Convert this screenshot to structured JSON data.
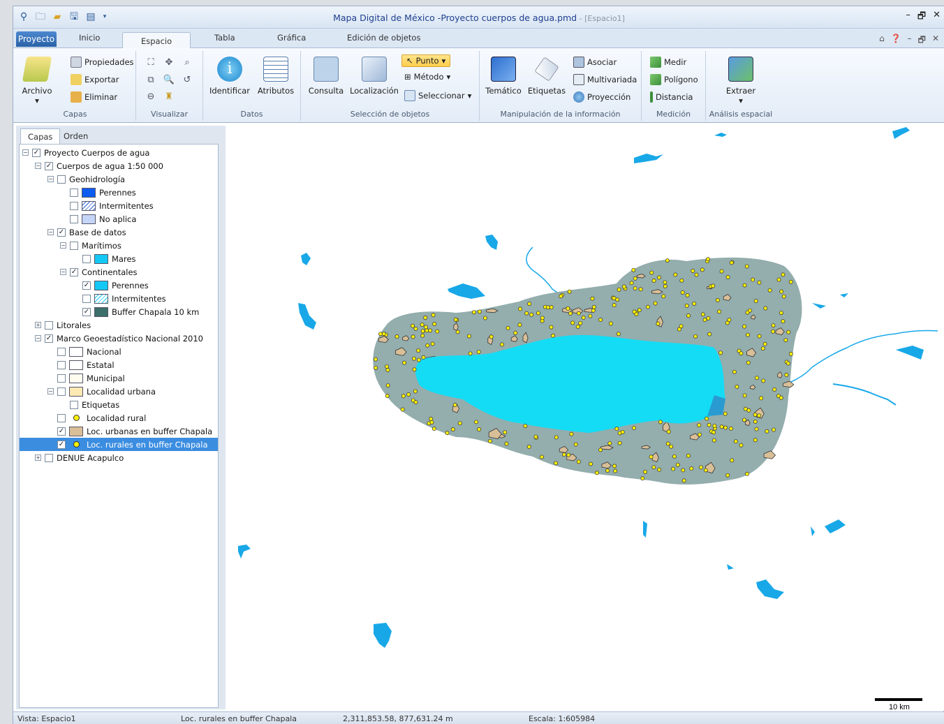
{
  "window": {
    "title": "Mapa Digital de México -Proyecto cuerpos de agua.pmd",
    "space": " - [Espacio1]",
    "controls": [
      "–",
      "🗗",
      "✕"
    ]
  },
  "quick_access": [
    "location-pin-icon",
    "open-folder-icon",
    "folder-icon",
    "save-icon",
    "table-icon"
  ],
  "ribbon_tabs": {
    "file": "Proyecto",
    "tabs": [
      "Inicio",
      "Espacio",
      "Tabla",
      "Gráfica",
      "Edición de objetos"
    ],
    "active": "Espacio"
  },
  "ribbon": {
    "capas": {
      "label": "Capas",
      "archivo": "Archivo",
      "propiedades": "Propiedades",
      "exportar": "Exportar",
      "eliminar": "Eliminar"
    },
    "visualizar": {
      "label": "Visualizar"
    },
    "datos": {
      "label": "Datos",
      "identificar": "Identificar",
      "atributos": "Atributos"
    },
    "seleccion": {
      "label": "Selección de objetos",
      "consulta": "Consulta",
      "localizacion": "Localización",
      "punto": "Punto",
      "metodo": "Método",
      "seleccionar": "Seleccionar"
    },
    "manipulacion": {
      "label": "Manipulación de la información",
      "tematico": "Temático",
      "etiquetas": "Etiquetas",
      "asociar": "Asociar",
      "multivariada": "Multivariada",
      "proyeccion": "Proyección"
    },
    "medicion": {
      "label": "Medición",
      "medir": "Medir",
      "poligono": "Polígono",
      "distancia": "Distancia"
    },
    "analisis": {
      "label": "Análisis espacial",
      "extraer": "Extraer"
    }
  },
  "panel_tabs": [
    "Capas",
    "Orden"
  ],
  "tree": [
    {
      "label": "Proyecto Cuerpos de agua",
      "exp": "⊟",
      "checked": true
    },
    {
      "label": "Cuerpos de agua 1:50 000",
      "exp": "⊟",
      "checked": true
    },
    {
      "label": "Geohidrología",
      "exp": "⊟",
      "checked": false
    },
    {
      "label": "Perennes",
      "checked": false,
      "swatch": "#0d5cf0"
    },
    {
      "label": "Intermitentes",
      "checked": false,
      "swatch": "hatch"
    },
    {
      "label": "No aplica",
      "checked": false,
      "swatch": "#c4d5f7"
    },
    {
      "label": "Base de datos",
      "exp": "⊟",
      "checked": true
    },
    {
      "label": "Marítimos",
      "exp": "⊟",
      "checked": false
    },
    {
      "label": "Mares",
      "checked": false,
      "swatch": "#14c8f5"
    },
    {
      "label": "Continentales",
      "exp": "⊟",
      "checked": true
    },
    {
      "label": "Perennes",
      "checked": true,
      "swatch": "#14c8f5"
    },
    {
      "label": "Intermitentes",
      "checked": false,
      "swatch": "hatch2"
    },
    {
      "label": "Buffer Chapala 10 km",
      "checked": true,
      "swatch": "#3c6e6a"
    },
    {
      "label": "Litorales",
      "exp": "⊞",
      "checked": false
    },
    {
      "label": "Marco Geoestadístico Nacional 2010",
      "exp": "⊟",
      "checked": true
    },
    {
      "label": "Nacional",
      "checked": false,
      "swatch": "#ffffff"
    },
    {
      "label": "Estatal",
      "checked": false,
      "swatch": "#ffffff"
    },
    {
      "label": "Municipal",
      "checked": false,
      "swatch": "#fffdf0"
    },
    {
      "label": "Localidad urbana",
      "exp": "⊟",
      "checked": false,
      "swatch": "#fde9b4"
    },
    {
      "label": "Etiquetas",
      "checked": false
    },
    {
      "label": "Localidad rural",
      "checked": false,
      "swatch": "dot"
    },
    {
      "label": "Loc. urbanas en buffer Chapala",
      "checked": true,
      "swatch": "#d9bf98"
    },
    {
      "label": "Loc. rurales en buffer Chapala",
      "checked": true,
      "swatch": "dot",
      "selected": true
    },
    {
      "label": "DENUE Acapulco",
      "exp": "⊞",
      "checked": false
    }
  ],
  "map": {
    "scale_label": "10 km",
    "colors": {
      "buffer": "#94adad",
      "lake": "#14dcf5",
      "urban": "#d9bf98",
      "rural": "#fff200",
      "water": "#18a8e8"
    }
  },
  "status": {
    "view": "Vista: Espacio1",
    "layer": "Loc. rurales en buffer Chapala",
    "coords": "2,311,853.58, 877,631.24 m",
    "scale": "Escala: 1:605984"
  }
}
